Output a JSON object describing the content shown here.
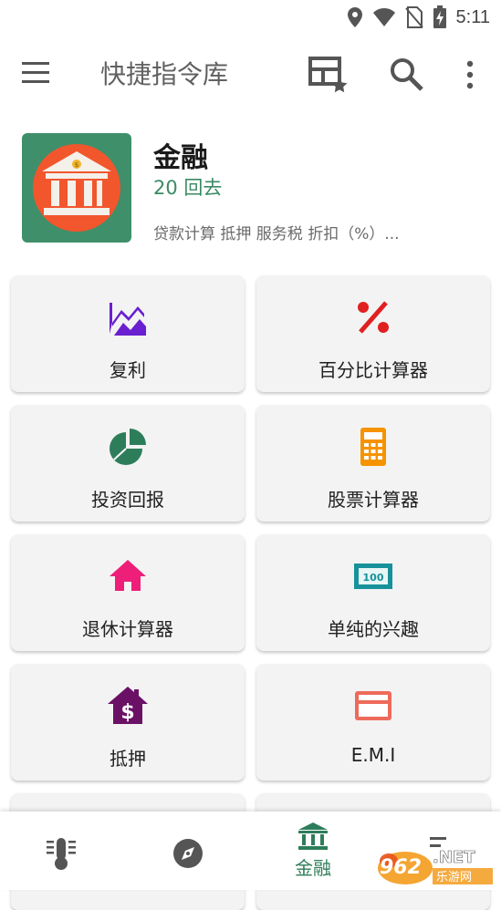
{
  "status": {
    "time": "5:11"
  },
  "app_bar": {
    "title": "快捷指令库"
  },
  "category": {
    "title": "金融",
    "count": "20 回去",
    "description": "贷款计算 抵押 服务税 折扣（%）..."
  },
  "tiles": [
    {
      "label": "复利",
      "icon": "trending-chart-icon",
      "color": "#6a1fd0"
    },
    {
      "label": "百分比计算器",
      "icon": "percent-icon",
      "color": "#e02020"
    },
    {
      "label": "投资回报",
      "icon": "pie-chart-icon",
      "color": "#2e7d5a"
    },
    {
      "label": "股票计算器",
      "icon": "calculator-icon",
      "color": "#f59300"
    },
    {
      "label": "退休计算器",
      "icon": "home-icon",
      "color": "#ee1f78"
    },
    {
      "label": "单纯的兴趣",
      "icon": "banknote-icon",
      "color": "#17919a"
    },
    {
      "label": "抵押",
      "icon": "house-dollar-icon",
      "color": "#6a1166"
    },
    {
      "label": "E.M.I",
      "icon": "credit-card-icon",
      "color": "#ee6a5a"
    }
  ],
  "bottom_nav": {
    "items": [
      {
        "icon": "thermometer-icon"
      },
      {
        "icon": "compass-icon"
      },
      {
        "icon": "bank-icon",
        "label": "金融",
        "active": true
      },
      {
        "icon": "more-icon"
      }
    ]
  },
  "watermark": {
    "text": "962.NET",
    "subtext": "乐游网"
  }
}
